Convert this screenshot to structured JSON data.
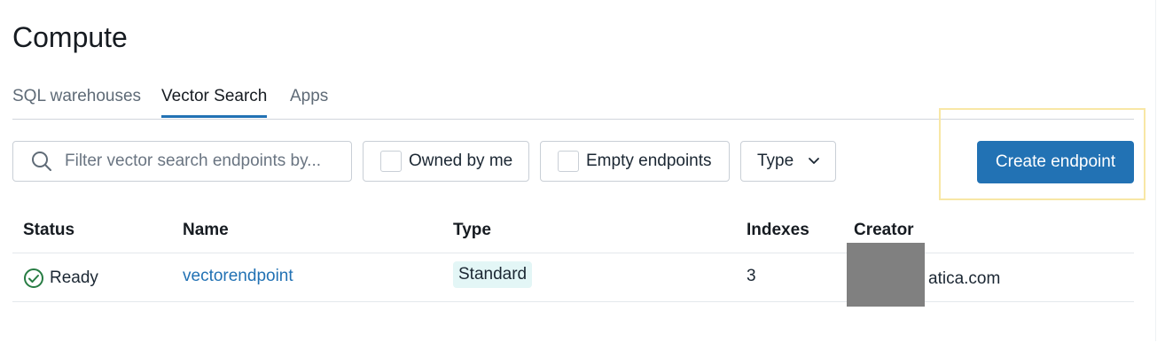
{
  "page": {
    "title": "Compute"
  },
  "tabs": [
    {
      "label": "SQL warehouses",
      "active": false
    },
    {
      "label": "Vector Search",
      "active": true
    },
    {
      "label": "Apps",
      "active": false
    }
  ],
  "filters": {
    "search_placeholder": "Filter vector search endpoints by...",
    "owned_by_me": "Owned by me",
    "empty_endpoints": "Empty endpoints",
    "type": "Type"
  },
  "actions": {
    "create_endpoint": "Create endpoint"
  },
  "table": {
    "columns": [
      "Status",
      "Name",
      "Type",
      "Indexes",
      "Creator"
    ],
    "rows": [
      {
        "status": "Ready",
        "name": "vectorendpoint",
        "type": "Standard",
        "indexes": "3",
        "creator": "atica.com"
      }
    ]
  },
  "colors": {
    "accent": "#2272b4",
    "badge_bg": "#e3f6f6",
    "ready_green": "#277c43"
  },
  "icons": {
    "search": "search-icon",
    "ready": "check-circle-icon",
    "dropdown": "chevron-down-icon"
  }
}
